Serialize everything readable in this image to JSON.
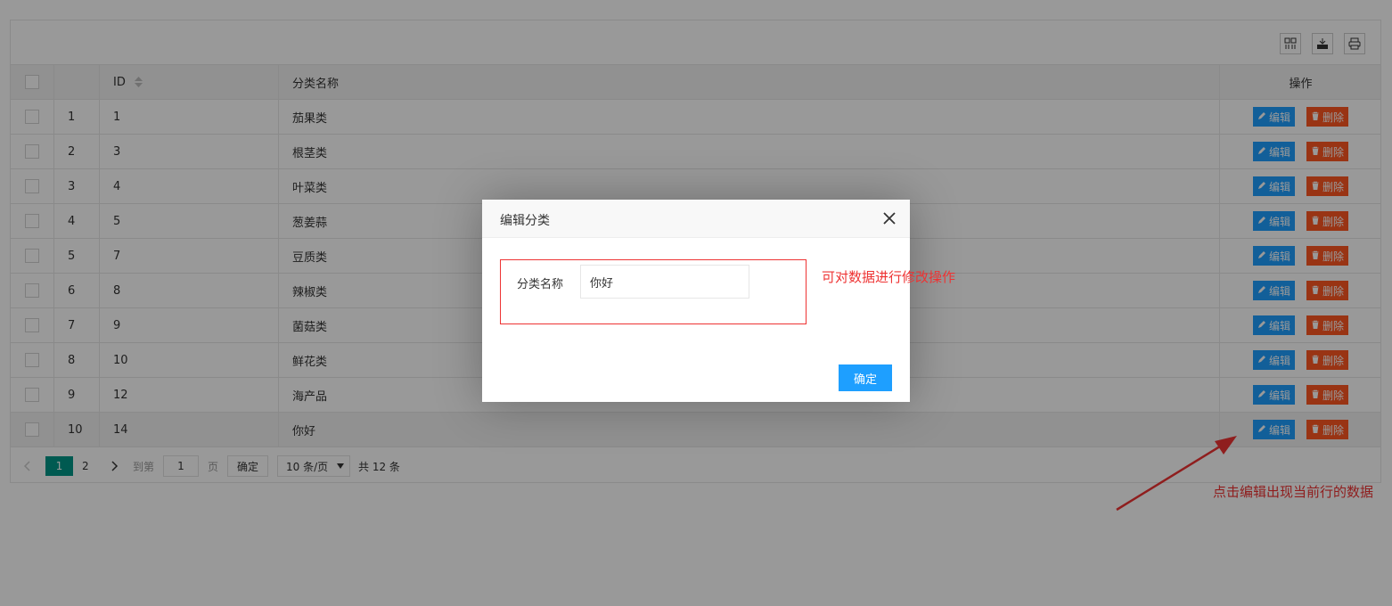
{
  "table": {
    "toolbar": {
      "columns_icon": "columns-icon",
      "export_icon": "export-icon",
      "print_icon": "print-icon"
    },
    "headers": {
      "id": "ID",
      "name": "分类名称",
      "ops": "操作"
    },
    "rows": [
      {
        "no": "1",
        "id": "1",
        "name": "茄果类"
      },
      {
        "no": "2",
        "id": "3",
        "name": "根茎类"
      },
      {
        "no": "3",
        "id": "4",
        "name": "叶菜类"
      },
      {
        "no": "4",
        "id": "5",
        "name": "葱姜蒜"
      },
      {
        "no": "5",
        "id": "7",
        "name": "豆质类"
      },
      {
        "no": "6",
        "id": "8",
        "name": "辣椒类"
      },
      {
        "no": "7",
        "id": "9",
        "name": "菌菇类"
      },
      {
        "no": "8",
        "id": "10",
        "name": "鲜花类"
      },
      {
        "no": "9",
        "id": "12",
        "name": "海产品"
      },
      {
        "no": "10",
        "id": "14",
        "name": "你好"
      }
    ],
    "edit_label": "编辑",
    "delete_label": "删除"
  },
  "pager": {
    "page1": "1",
    "page2": "2",
    "goto_label": "到第",
    "goto_value": "1",
    "page_unit": "页",
    "confirm": "确定",
    "page_size": "10 条/页",
    "total": "共 12 条"
  },
  "modal": {
    "title": "编辑分类",
    "field_label": "分类名称",
    "field_value": "你好",
    "ok": "确定"
  },
  "annotations": {
    "modal_note": "可对数据进行修改操作",
    "edit_note": "点击编辑出现当前行的数据"
  },
  "colors": {
    "primary": "#1E9FFF",
    "danger": "#FF5722",
    "pager_active": "#009688",
    "annotation": "#EE3333"
  }
}
